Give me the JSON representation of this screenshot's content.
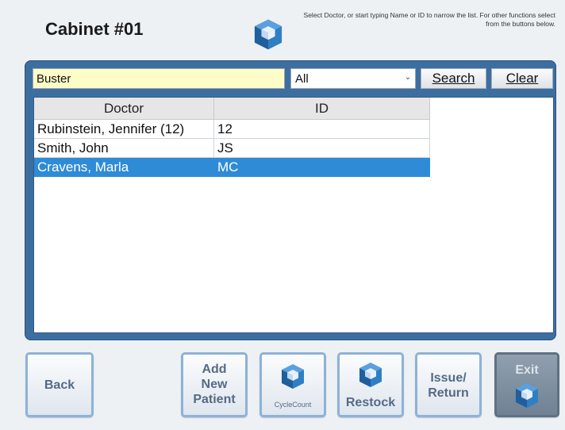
{
  "header": {
    "title": "Cabinet #01",
    "instructions": "Select Doctor, or start typing Name or ID to narrow the list. For other functions select from the buttons below.",
    "logo_icon": "cube-logo-icon"
  },
  "search": {
    "value": "Buster",
    "filter_selected": "All",
    "search_label": "Search",
    "clear_label": "Clear"
  },
  "table": {
    "columns": [
      "Doctor",
      "ID"
    ],
    "rows": [
      {
        "doctor": "Rubinstein, Jennifer (12)",
        "id": "12"
      },
      {
        "doctor": "Smith, John",
        "id": "JS"
      },
      {
        "doctor": "Cravens, Marla",
        "id": "MC",
        "selected": true
      }
    ]
  },
  "buttons": {
    "back": "Back",
    "add_new_patient": "Add New Patient",
    "cycle_count": "CycleCount",
    "restock": "Restock",
    "issue_return": "Issue/ Return",
    "exit": "Exit"
  },
  "colors": {
    "panel": "#3d6ea0",
    "selection": "#2f8bd6",
    "search_bg": "#fefdc8",
    "button_text": "#556a86"
  }
}
